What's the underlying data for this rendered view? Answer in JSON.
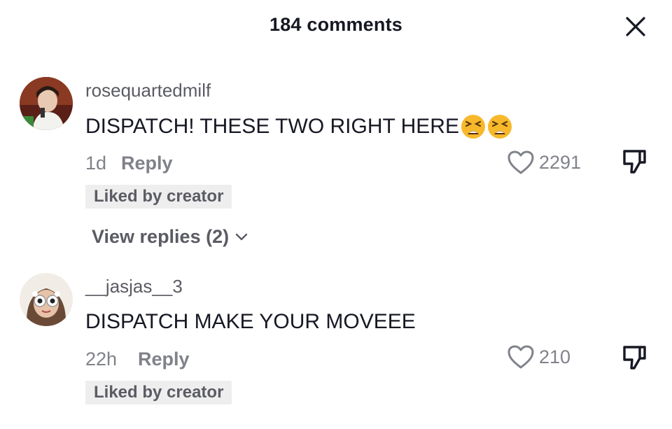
{
  "header": {
    "title": "184 comments",
    "close_icon": "close-icon"
  },
  "comments": [
    {
      "username": "rosequartedmilf",
      "text": "DISPATCH! THESE TWO RIGHT HERE",
      "emojis": [
        "tired-face-emoji",
        "tired-face-emoji"
      ],
      "time": "1d",
      "reply_label": "Reply",
      "likes": "2291",
      "badge": "Liked by creator",
      "view_replies": "View replies (2)"
    },
    {
      "username": "__jasjas__3",
      "text": "DISPATCH MAKE YOUR MOVEEE",
      "time": "22h",
      "reply_label": "Reply",
      "likes": "210",
      "badge": "Liked by creator"
    }
  ],
  "colors": {
    "primary_text": "#161823",
    "secondary_text": "#80828a",
    "username": "#5b5c63",
    "badge_bg": "#eeeeef",
    "emoji_face": "#f7b92b"
  }
}
